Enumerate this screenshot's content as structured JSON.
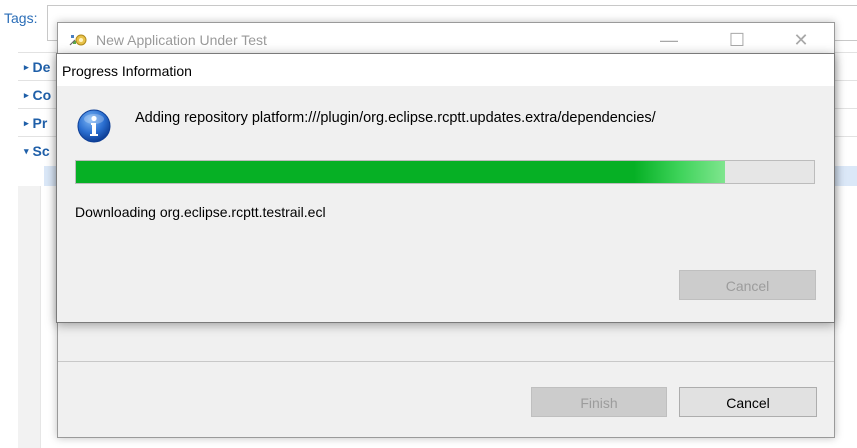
{
  "background": {
    "tags_label": "Tags:",
    "sections": [
      {
        "label": "De"
      },
      {
        "label": "Co"
      },
      {
        "label": "Pr"
      },
      {
        "label": "Sc"
      }
    ]
  },
  "wizard": {
    "title": "New Application Under Test",
    "minimize_glyph": "—",
    "maximize_glyph": "☐",
    "close_glyph": "✕",
    "finish_label": "Finish",
    "cancel_label": "Cancel"
  },
  "progress_dialog": {
    "title": "Progress Information",
    "message": "Adding repository platform:///plugin/org.eclipse.rcptt.updates.extra/dependencies/",
    "sub_message": "Downloading org.eclipse.rcptt.testrail.ecl",
    "progress_fraction": 0.88,
    "cancel_label": "Cancel",
    "icon": "info-icon"
  },
  "colors": {
    "progress_green": "#06b025",
    "section_blue": "#1f5fa8"
  }
}
